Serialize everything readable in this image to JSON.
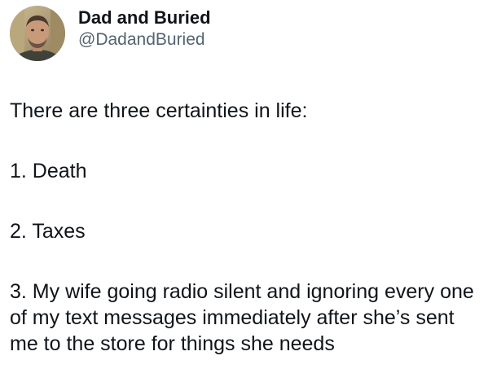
{
  "tweet": {
    "author": {
      "display_name": "Dad and Buried",
      "handle": "@DadandBuried",
      "avatar_icon": "profile-photo"
    },
    "text": {
      "intro": "There are three certainties in life:",
      "item_1": "1. Death",
      "item_2": "2. Taxes",
      "item_3": "3. My wife going radio silent and ignoring every one of my text messages immediately after she’s sent me to the store for things she needs"
    }
  }
}
